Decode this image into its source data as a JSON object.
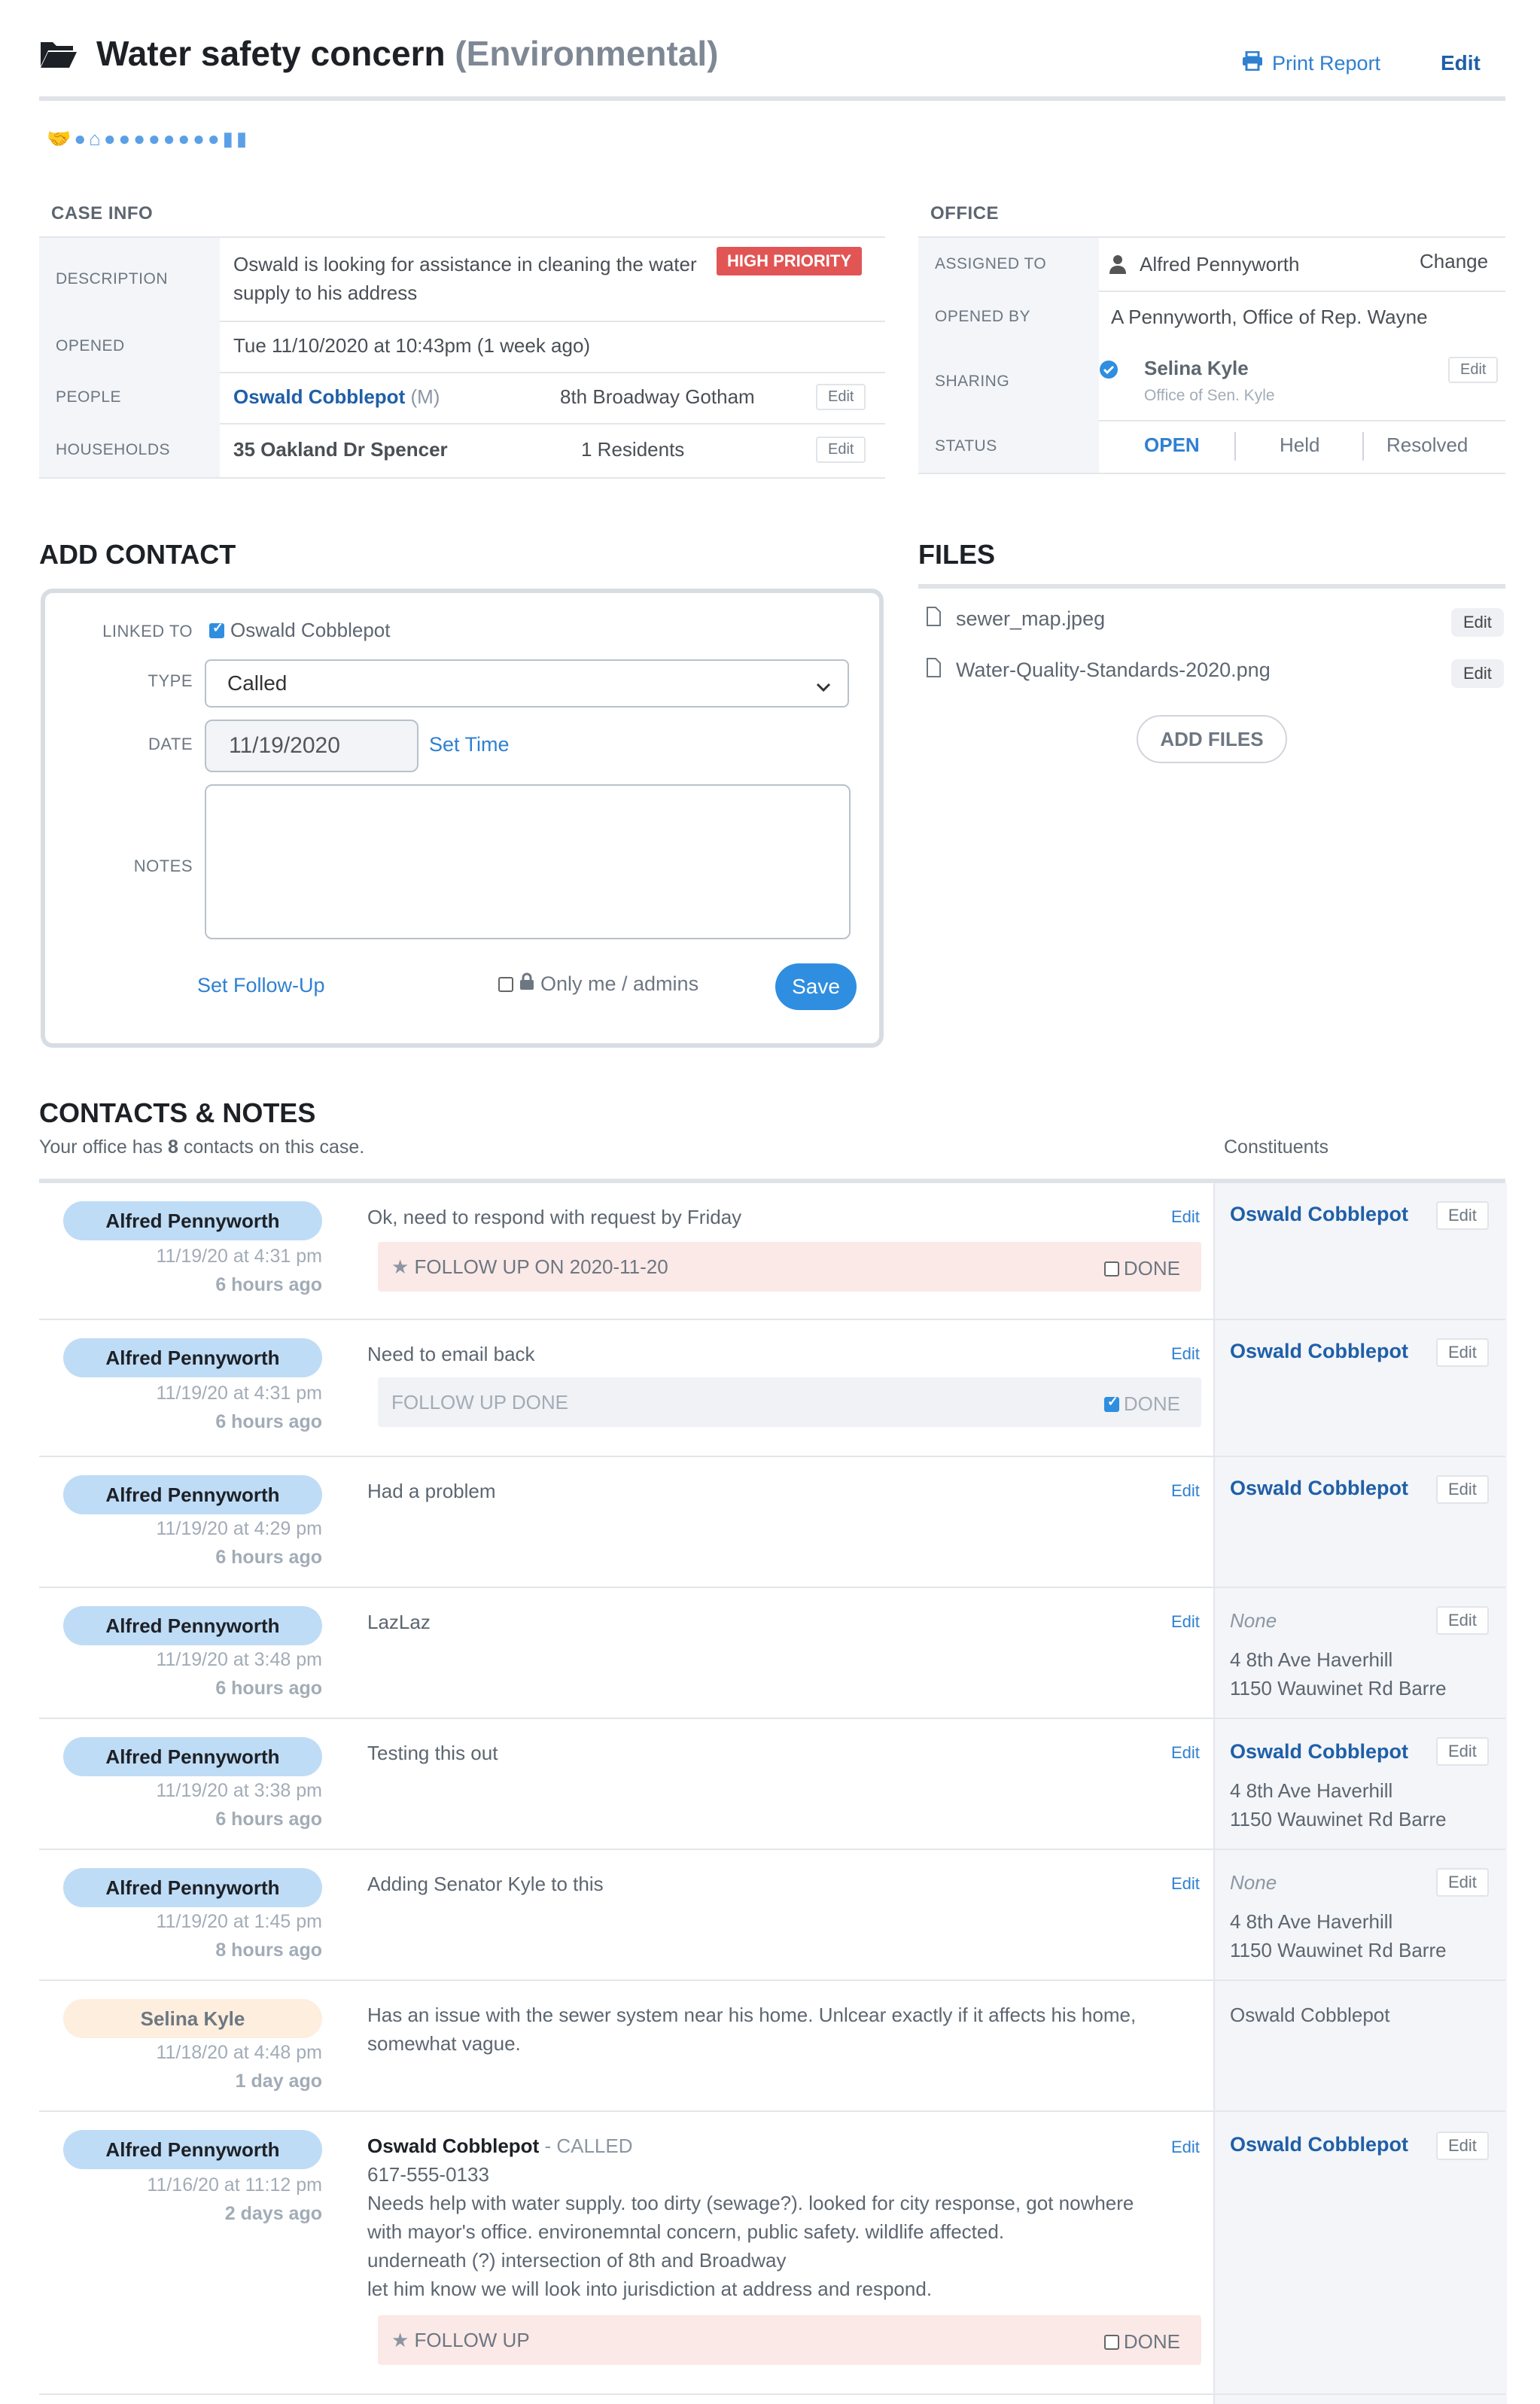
{
  "header": {
    "title": "Water safety concern",
    "category": "(Environmental)",
    "print_label": "Print Report",
    "edit_label": "Edit",
    "icons": [
      "handshake-icon",
      "person-icon",
      "house-icon",
      "comment-icon",
      "comment-icon",
      "comment-icon",
      "comment-icon",
      "comment-icon",
      "comment-icon",
      "comment-icon",
      "comment-icon",
      "document-icon",
      "document-icon"
    ]
  },
  "case_info": {
    "heading": "CASE INFO",
    "description_label": "DESCRIPTION",
    "description": "Oswald is looking for assistance in cleaning the water supply to his address",
    "priority_badge": "HIGH PRIORITY",
    "opened_label": "OPENED",
    "opened": "Tue 11/10/2020 at 10:43pm (1 week ago)",
    "people_label": "PEOPLE",
    "person_name": "Oswald Cobblepot",
    "person_gender": "(M)",
    "person_address": "8th Broadway Gotham",
    "households_label": "HOUSEHOLDS",
    "household": "35 Oakland Dr Spencer",
    "household_residents": "1 Residents",
    "edit_label": "Edit"
  },
  "office": {
    "heading": "OFFICE",
    "assigned_label": "ASSIGNED TO",
    "assigned_to": "Alfred Pennyworth",
    "change_label": "Change",
    "opened_by_label": "OPENED BY",
    "opened_by": "A Pennyworth, Office of Rep. Wayne",
    "sharing_label": "SHARING",
    "sharing_name": "Selina Kyle",
    "sharing_office": "Office of Sen. Kyle",
    "edit_label": "Edit",
    "status_label": "STATUS",
    "status_options": [
      "OPEN",
      "Held",
      "Resolved"
    ]
  },
  "add_contact": {
    "heading": "ADD CONTACT",
    "linked_label": "LINKED TO",
    "linked_value": "Oswald Cobblepot",
    "type_label": "TYPE",
    "type_value": "Called",
    "date_label": "DATE",
    "date_value": "11/19/2020",
    "set_time": "Set Time",
    "notes_label": "NOTES",
    "set_followup": "Set Follow-Up",
    "only_me": "Only me / admins",
    "save": "Save"
  },
  "files": {
    "heading": "FILES",
    "items": [
      {
        "name": "sewer_map.jpeg",
        "edit": "Edit"
      },
      {
        "name": "Water-Quality-Standards-2020.png",
        "edit": "Edit"
      }
    ],
    "add_files": "ADD FILES"
  },
  "contacts": {
    "heading": "CONTACTS & NOTES",
    "summary_prefix": "Your office has ",
    "summary_count": "8",
    "summary_suffix": " contacts on this case.",
    "constituents_label": "Constituents",
    "edit_label": "Edit",
    "done_label": "DONE",
    "rows": [
      {
        "author": "Alfred Pennyworth",
        "date": "11/19/20 at 4:31 pm",
        "ago": "6 hours ago",
        "note": "Ok, need to respond with request by Friday",
        "followup": "FOLLOW UP ON 2020-11-20",
        "constituent": "Oswald Cobblepot"
      },
      {
        "author": "Alfred Pennyworth",
        "date": "11/19/20 at 4:31 pm",
        "ago": "6 hours ago",
        "note": "Need to email back",
        "followup": "FOLLOW UP DONE",
        "constituent": "Oswald Cobblepot"
      },
      {
        "author": "Alfred Pennyworth",
        "date": "11/19/20 at 4:29 pm",
        "ago": "6 hours ago",
        "note": "Had a problem",
        "constituent": "Oswald Cobblepot"
      },
      {
        "author": "Alfred Pennyworth",
        "date": "11/19/20 at 3:48 pm",
        "ago": "6 hours ago",
        "note": "LazLaz",
        "constituent": "None",
        "addr1": "4 8th Ave Haverhill",
        "addr2": "1150 Wauwinet Rd Barre"
      },
      {
        "author": "Alfred Pennyworth",
        "date": "11/19/20 at 3:38 pm",
        "ago": "6 hours ago",
        "note": "Testing this out",
        "constituent": "Oswald Cobblepot",
        "addr1": "4 8th Ave Haverhill",
        "addr2": "1150 Wauwinet Rd Barre"
      },
      {
        "author": "Alfred Pennyworth",
        "date": "11/19/20 at 1:45 pm",
        "ago": "8 hours ago",
        "note": "Adding Senator Kyle to this",
        "constituent": "None",
        "addr1": "4 8th Ave Haverhill",
        "addr2": "1150 Wauwinet Rd Barre"
      },
      {
        "author": "Selina Kyle",
        "date": "11/18/20 at 4:48 pm",
        "ago": "1 day ago",
        "note_l1": "Has an issue with the sewer system near his home. Unlcear exactly if it affects his home,",
        "note_l2": "somewhat vague.",
        "constituent": "Oswald Cobblepot"
      },
      {
        "author": "Alfred Pennyworth",
        "date": "11/16/20 at 11:12 pm",
        "ago": "2 days ago",
        "title_name": "Oswald Cobblepot",
        "title_type": " - CALLED",
        "phone": "617-555-0133",
        "body1": "Needs help with water supply. too dirty (sewage?). looked for city response, got nowhere",
        "body2": "with mayor's office. environemntal concern, public safety. wildlife affected.",
        "body3": "underneath (?) intersection of 8th and Broadway",
        "body4": "let him know we will look into jurisdiction at address and respond.",
        "followup": "FOLLOW UP",
        "constituent": "Oswald Cobblepot"
      }
    ]
  },
  "colors": {
    "accent": "#2f80d1",
    "badge": "#e25555",
    "pill": "#bfdcf6",
    "pill_alt": "#fdeede",
    "followup_bg": "#fbe9e7"
  }
}
